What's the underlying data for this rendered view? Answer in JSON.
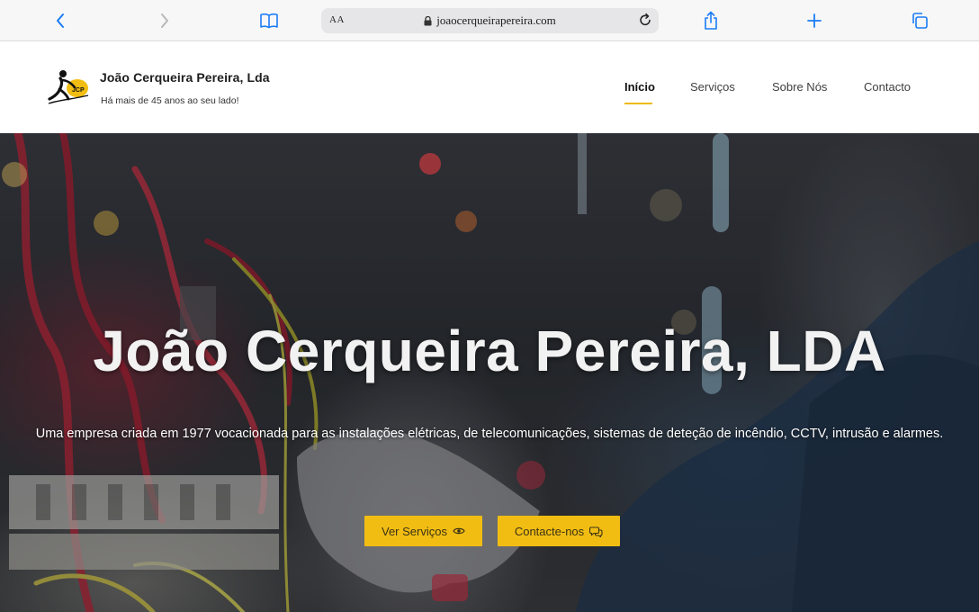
{
  "browser": {
    "address_aa": "AA",
    "url": "joaocerqueirapereira.com",
    "icons": [
      "chevron-left-icon",
      "chevron-right-icon",
      "book-icon",
      "lock-icon",
      "reload-icon",
      "share-icon",
      "plus-icon",
      "tabs-icon"
    ]
  },
  "header": {
    "company_name": "João Cerqueira Pereira, Lda",
    "tagline": "Há mais de 45 anos ao seu lado!",
    "nav": [
      "Início",
      "Serviços",
      "Sobre Nós",
      "Contacto"
    ],
    "active_nav": "Início"
  },
  "hero": {
    "title": "João Cerqueira Pereira, LDA",
    "subtitle": "Uma empresa criada em 1977 vocacionada para as instalações elétricas, de telecomunicações, sistemas de deteção de incêndio, CCTV, intrusão e alarmes.",
    "buttons": {
      "services": "Ver Serviços",
      "contact": "Contacte-nos"
    }
  },
  "colors": {
    "accent": "#f1bd13",
    "browser_blue": "#1a7cf5"
  }
}
